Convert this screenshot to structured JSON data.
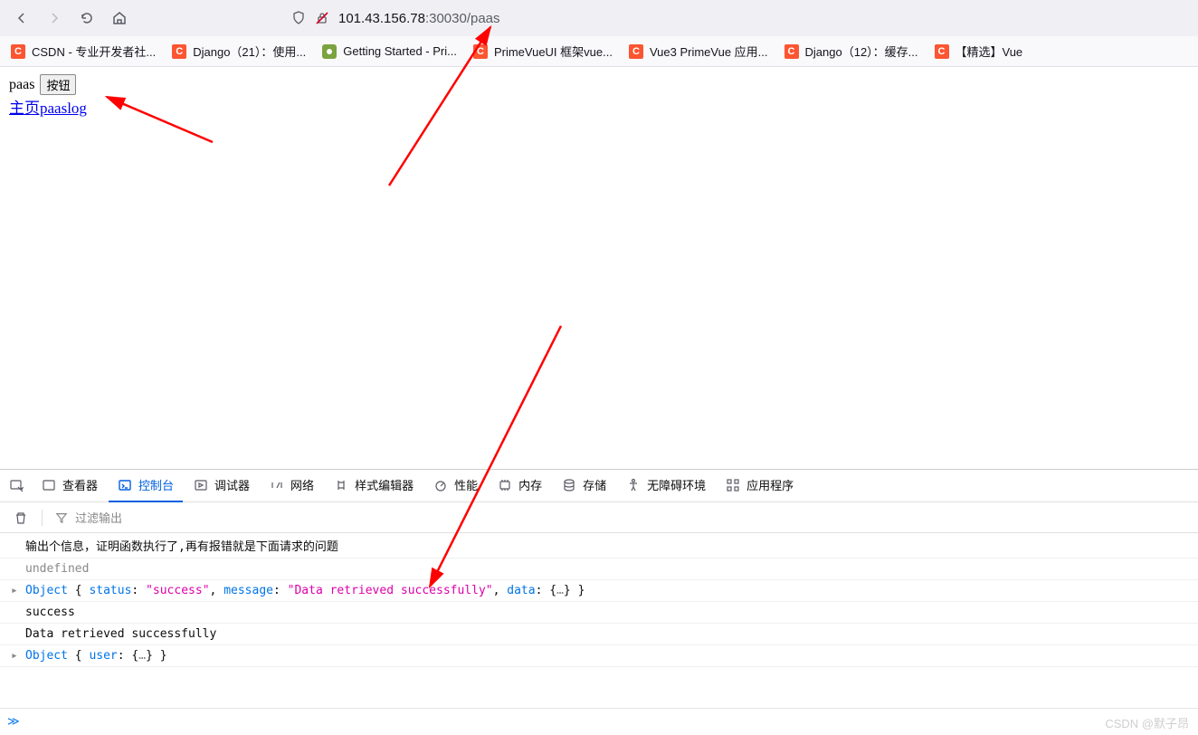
{
  "url": {
    "host": "101.43.156.78",
    "rest": ":30030/paas"
  },
  "bookmarks": [
    {
      "icon": "c",
      "label": "CSDN - 专业开发者社..."
    },
    {
      "icon": "c",
      "label": "Django（21）：使用..."
    },
    {
      "icon": "b",
      "label": "Getting Started - Pri..."
    },
    {
      "icon": "c",
      "label": "PrimeVueUI 框架vue..."
    },
    {
      "icon": "c",
      "label": "Vue3 PrimeVue 应用..."
    },
    {
      "icon": "c",
      "label": "Django（12）：缓存..."
    },
    {
      "icon": "c",
      "label": "【精选】Vue"
    }
  ],
  "page": {
    "text1": "paas",
    "button": "按钮",
    "link": "主页paaslog"
  },
  "devtools": {
    "tabs": {
      "inspector": "查看器",
      "console": "控制台",
      "debugger": "调试器",
      "network": "网络",
      "styles": "样式编辑器",
      "performance": "性能",
      "memory": "内存",
      "storage": "存储",
      "a11y": "无障碍环境",
      "apps": "应用程序"
    },
    "filter_placeholder": "过滤输出",
    "console_lines": {
      "l1": "输出个信息，证明函数执行了,再有报错就是下面请求的问题",
      "l2": "undefined",
      "l3": {
        "obj": "Object",
        "k_status": "status",
        "v_status": "\"success\"",
        "k_message": "message",
        "v_message": "\"Data retrieved successfully\"",
        "k_data": "data"
      },
      "l4": "success",
      "l5": "Data retrieved successfully",
      "l6": {
        "obj": "Object",
        "k_user": "user"
      }
    },
    "prompt": "≫"
  },
  "watermark": "CSDN @默子昂"
}
